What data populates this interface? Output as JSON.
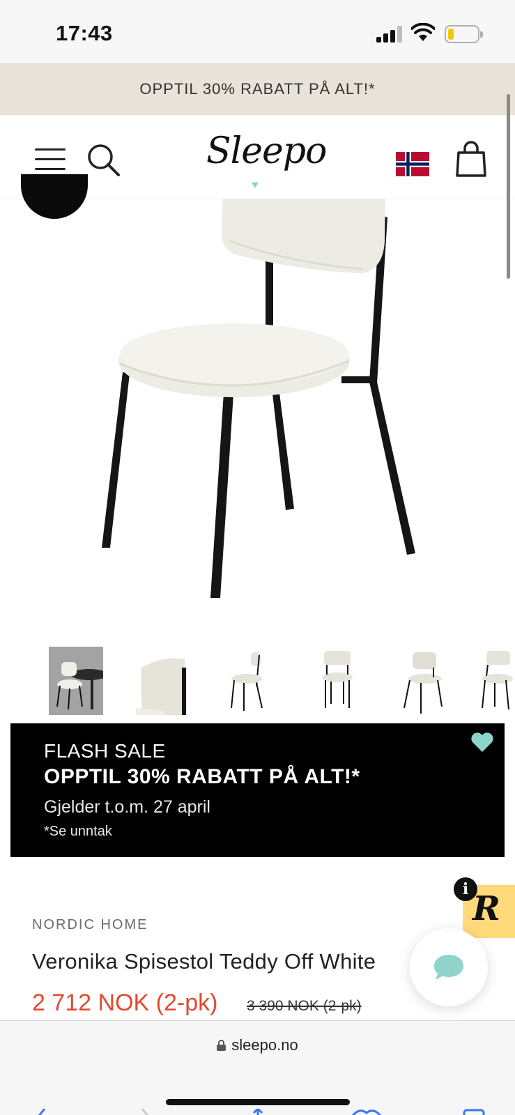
{
  "status_bar": {
    "time": "17:43",
    "battery_color": "#f2c80f"
  },
  "promo_banner": {
    "text": "OPPTIL 30% RABATT PÅ ALT!*",
    "background": "#e9e2d8"
  },
  "header": {
    "logo": "Sleepo",
    "logo_heart_color": "#8fd3cb",
    "icons": [
      "menu-icon",
      "search-icon",
      "norway-flag-icon",
      "shopping-bag-icon"
    ]
  },
  "gallery": {
    "thumbnails": [
      "chair-in-room",
      "backrest-closeup",
      "chair-side-view",
      "chair-front-view",
      "chair-back-view",
      "chair-angle-view"
    ]
  },
  "flash_sale": {
    "label": "FLASH SALE",
    "headline": "OPPTIL 30% RABATT PÅ ALT!*",
    "valid_until": "Gjelder t.o.m. 27 april",
    "exceptions": "*Se unntak",
    "heart_color": "#8fd3cb"
  },
  "product": {
    "brand": "NORDIC HOME",
    "title": "Veronika Spisestol Teddy Off White",
    "price": "2 712 NOK (2-pk)",
    "old_price": "3 390 NOK (2-pk)",
    "price_color": "#e24a2f"
  },
  "widgets": {
    "review_logo": "R",
    "info": "i"
  },
  "browser": {
    "url": "sleepo.no"
  }
}
